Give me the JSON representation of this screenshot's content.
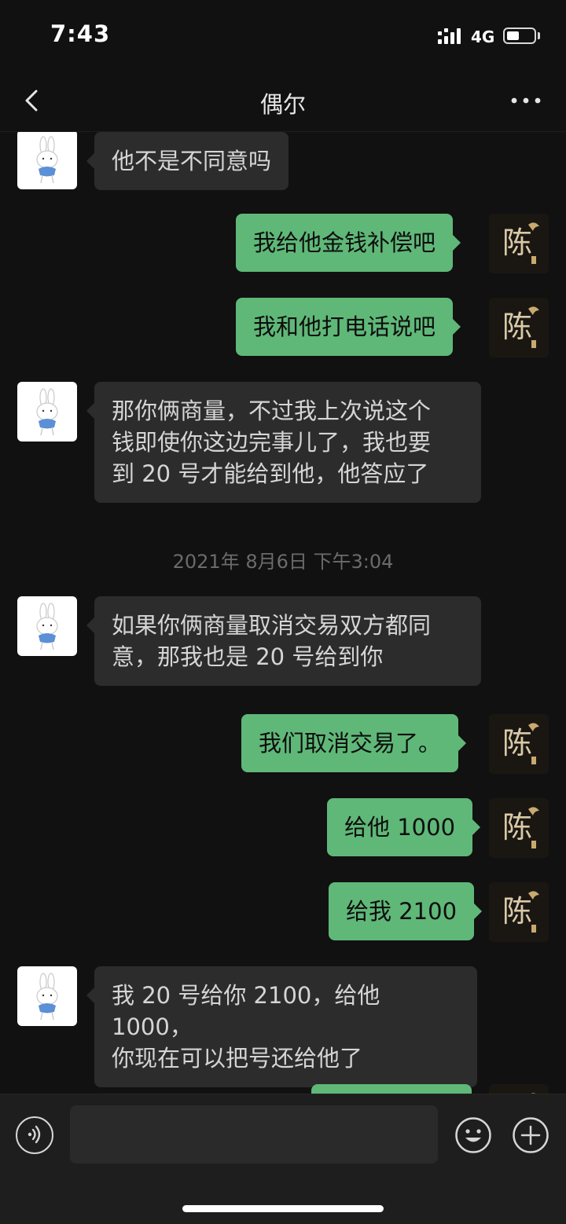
{
  "status": {
    "time": "7:43",
    "network": "4G",
    "battery_level": 0.45
  },
  "nav": {
    "title": "偶尔",
    "back_icon": "chevron-left-icon",
    "more_icon": "more-horizontal-icon"
  },
  "conversation": {
    "messages": [
      {
        "id": "m1",
        "side": "left",
        "text": "他不是不同意吗"
      },
      {
        "id": "m2",
        "side": "right",
        "text": "我给他金钱补偿吧"
      },
      {
        "id": "m3",
        "side": "right",
        "text": "我和他打电话说吧"
      },
      {
        "id": "m4",
        "side": "left",
        "text": "那你俩商量，不过我上次说这个\n钱即使你这边完事儿了，我也要\n到 20 号才能给到他，他答应了"
      },
      {
        "id": "m5",
        "side": "left",
        "text": "如果你俩商量取消交易双方都同\n意，那我也是 20 号给到你"
      },
      {
        "id": "m6",
        "side": "right",
        "text": "我们取消交易了。"
      },
      {
        "id": "m7",
        "side": "right",
        "text": "给他 1000"
      },
      {
        "id": "m8",
        "side": "right",
        "text": "给我 2100"
      },
      {
        "id": "m9",
        "side": "left",
        "text": "我 20 号给你 2100，给他 1000，\n你现在可以把号还给他了"
      },
      {
        "id": "m10",
        "side": "right",
        "text": ""
      }
    ],
    "timestamp": "2021年 8月6日 下午3:04",
    "my_avatar_char": "陈"
  },
  "input_bar": {
    "voice_icon": "voice-icon",
    "input_value": "",
    "emoji_icon": "emoji-icon",
    "plus_icon": "plus-circle-icon"
  },
  "colors": {
    "background": "#111111",
    "bubble_self": "#5fb878",
    "bubble_other": "#2c2c2c"
  }
}
